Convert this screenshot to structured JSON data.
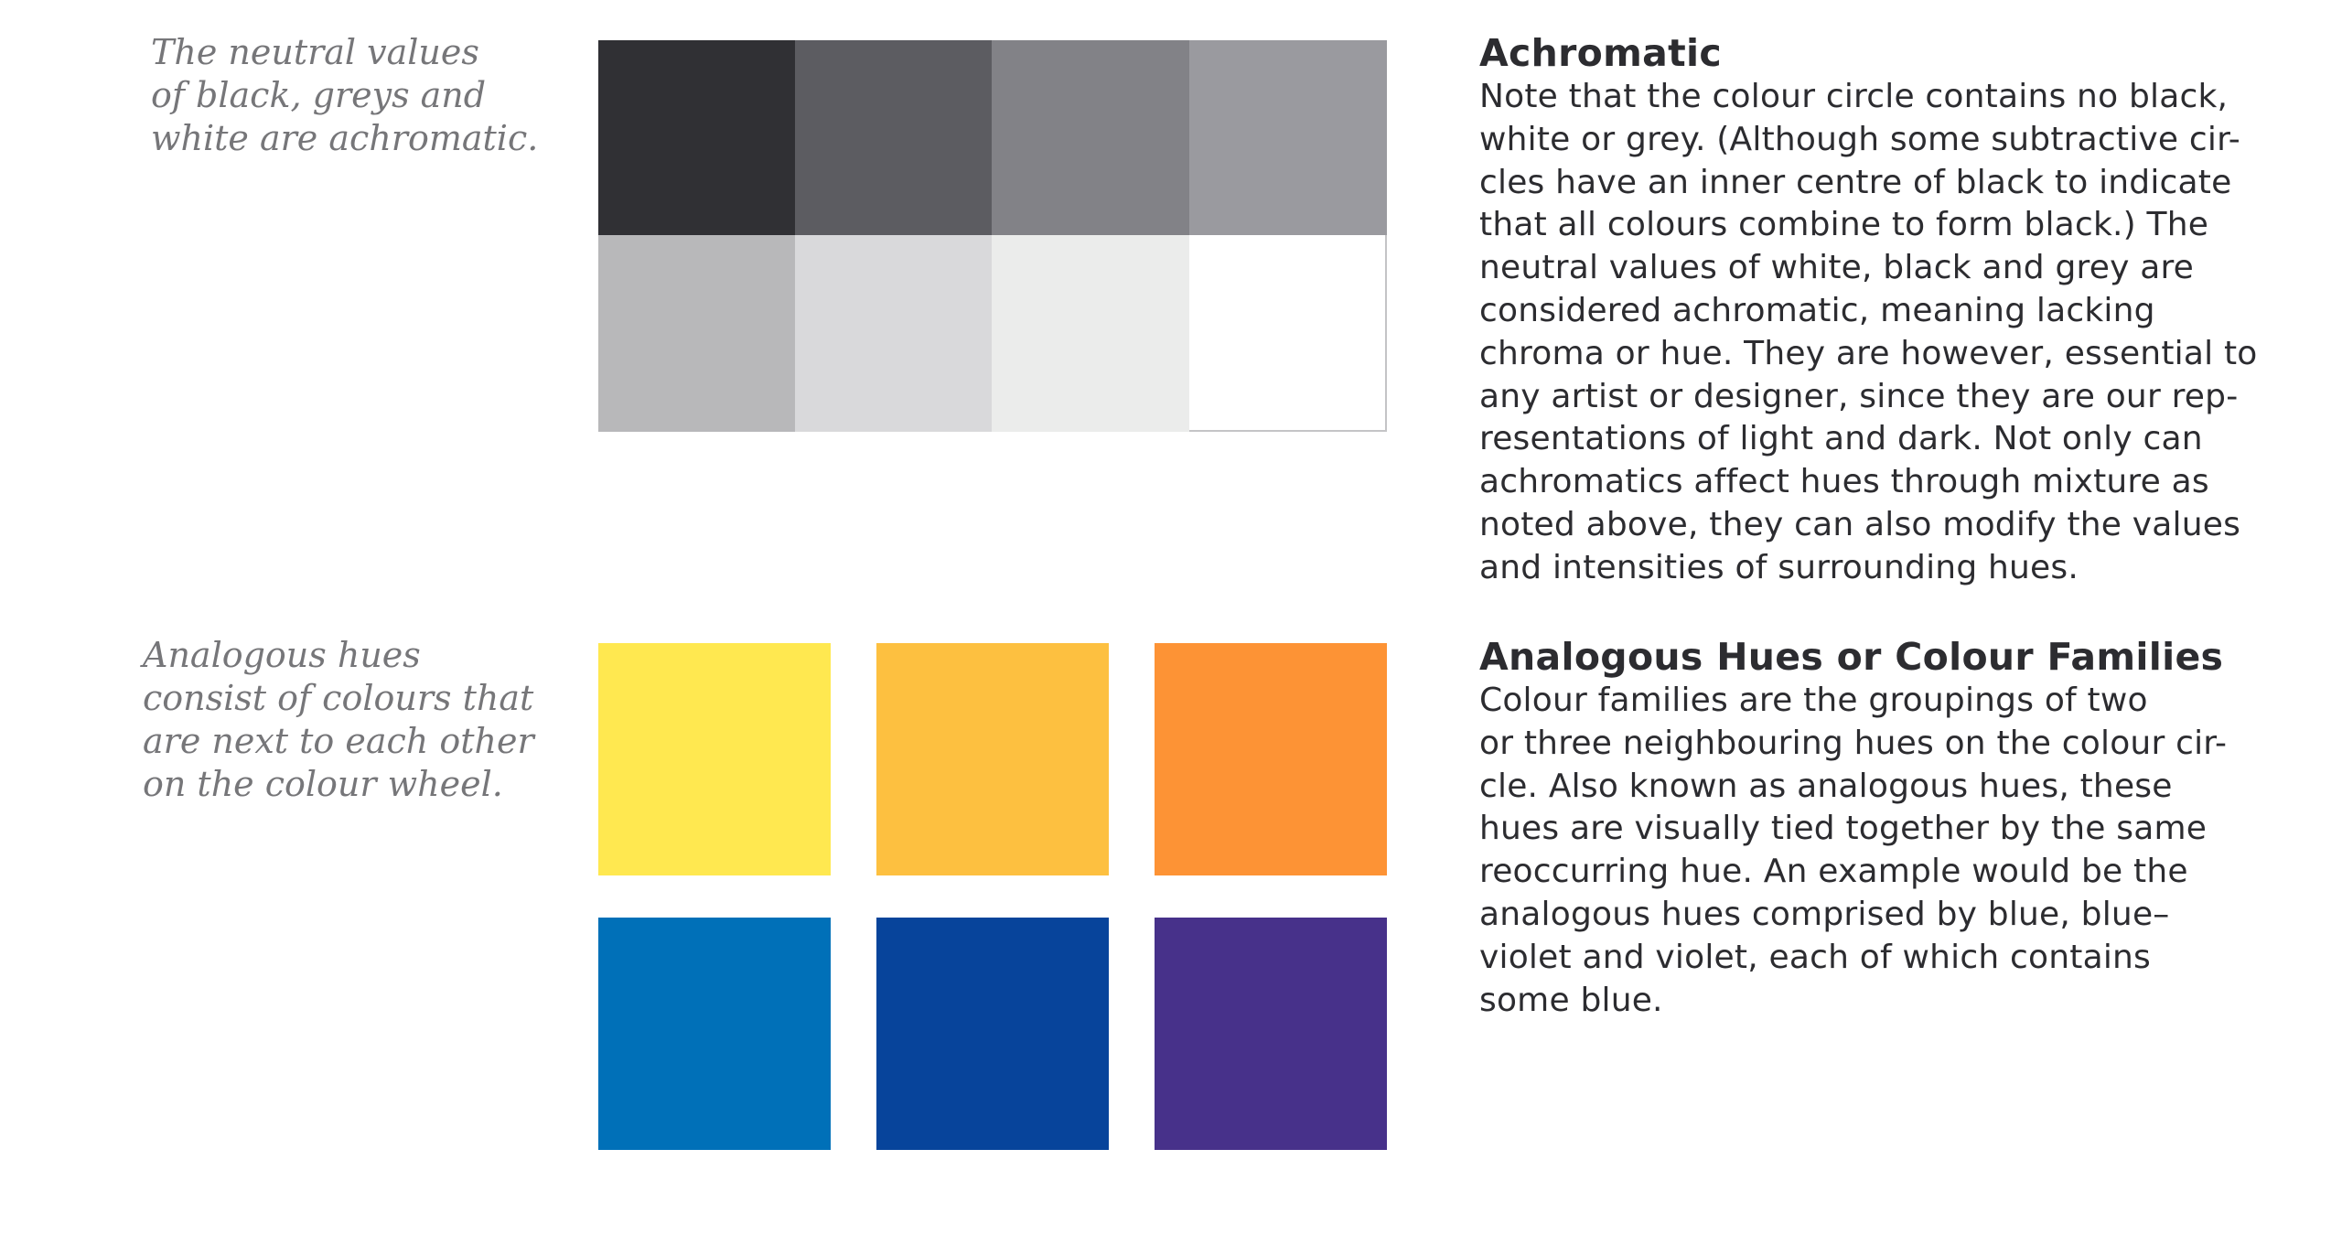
{
  "captions": {
    "achromatic": [
      "The neutral values",
      "of black, greys and",
      "white are achromatic."
    ],
    "analogous": [
      "Analogous hues",
      "consist of colours that",
      "are next to each other",
      "on the colour wheel."
    ]
  },
  "achromatic_swatches": [
    "#303034",
    "#5c5c61",
    "#828287",
    "#9a9a9f",
    "#b8b8ba",
    "#d9d9db",
    "#ebeceb",
    "#ffffff"
  ],
  "analogous_swatches": {
    "warm": [
      "#ffe850",
      "#fdc040",
      "#fd9335"
    ],
    "cool": [
      "#0070b8",
      "#07449b",
      "#47318a"
    ]
  },
  "sections": {
    "achromatic": {
      "title": "Achromatic",
      "lines": [
        "Note that the colour circle contains no black,",
        "white or grey. (Although some subtractive cir-",
        "cles have an inner centre of black to indicate",
        "that all colours combine to form black.) The",
        "neutral values of white, black and grey are",
        "considered achromatic, meaning lacking",
        "chroma or hue. They are however, essential to",
        "any artist or designer, since they are our rep-",
        "resentations of light and dark. Not only can",
        "achromatics affect hues through mixture as",
        "noted above, they can also modify the values",
        "and intensities of surrounding hues."
      ]
    },
    "analogous": {
      "title": "Analogous Hues or Colour Families",
      "lines": [
        "Colour families are the groupings of two",
        "or three neighbouring hues on the colour cir-",
        "cle. Also known as analogous hues, these",
        "hues are visually tied together by the same",
        "reoccurring hue. An example would be the",
        "analogous hues comprised by blue, blue–",
        "violet and violet, each of which contains",
        "some blue."
      ]
    }
  }
}
